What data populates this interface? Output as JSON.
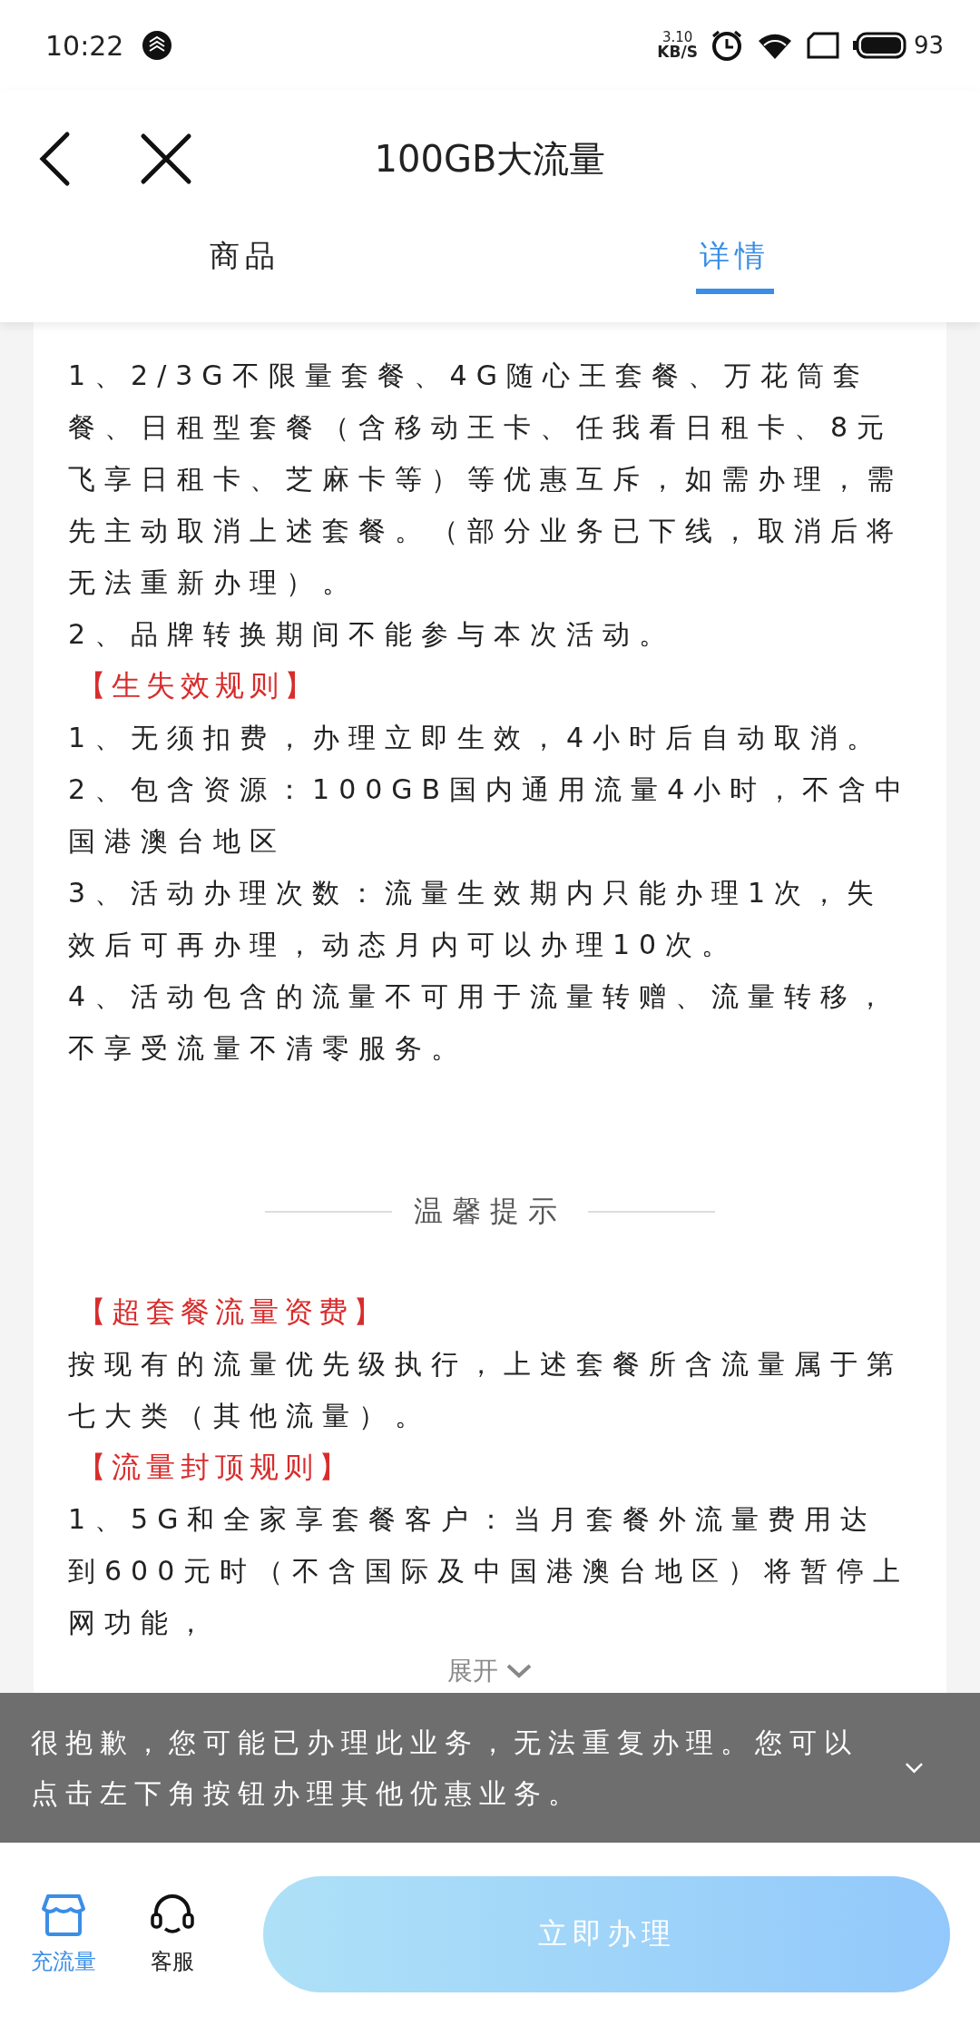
{
  "status_bar": {
    "time": "10:22",
    "speed_value": "3.10",
    "speed_unit": "KB/S",
    "battery": "93"
  },
  "header": {
    "title": "100GB大流量"
  },
  "tabs": [
    {
      "label": "商品",
      "selected": false
    },
    {
      "label": "详情",
      "selected": true
    }
  ],
  "sections": [
    {
      "kind": "paragraph",
      "text": "1、2/3G不限量套餐、4G随心王套餐、万花筒套餐、日租型套餐（含移动王卡、任我看日租卡、8元飞享日租卡、芝麻卡等）等优惠互斥，如需办理，需先主动取消上述套餐。（部分业务已下线，取消后将无法重新办理）。"
    },
    {
      "kind": "paragraph",
      "text": "2、品牌转换期间不能参与本次活动。"
    },
    {
      "kind": "heading",
      "text": "【生失效规则】"
    },
    {
      "kind": "paragraph",
      "text": "1、无须扣费，办理立即生效，4小时后自动取消。"
    },
    {
      "kind": "paragraph",
      "text": "2、包含资源：100GB国内通用流量4小时，不含中国港澳台地区"
    },
    {
      "kind": "paragraph",
      "text": "3、活动办理次数：流量生效期内只能办理1次，失效后可再办理，动态月内可以办理10次。"
    },
    {
      "kind": "paragraph",
      "text": "4、活动包含的流量不可用于流量转赠、流量转移，不享受流量不清零服务。"
    },
    {
      "kind": "divider",
      "text": "温馨提示"
    },
    {
      "kind": "heading",
      "text": "【超套餐流量资费】"
    },
    {
      "kind": "paragraph",
      "text": "按现有的流量优先级执行，上述套餐所含流量属于第七大类（其他流量）。"
    },
    {
      "kind": "heading",
      "text": "【流量封顶规则】"
    },
    {
      "kind": "paragraph",
      "text": "1、5G和全家享套餐客户：当月套餐外流量费用达到600元时（不含国际及中国港澳台地区）将暂停上网功能，"
    }
  ],
  "expand_label": "展开",
  "toast": {
    "message": "很抱歉，您可能已办理此业务，无法重复办理。您可以点击左下角按钮办理其他优惠业务。"
  },
  "bottom_nav": [
    {
      "label": "充流量",
      "selected": true
    },
    {
      "label": "客服",
      "selected": false
    }
  ],
  "action_button": {
    "label": "立即办理",
    "disabled": true
  }
}
